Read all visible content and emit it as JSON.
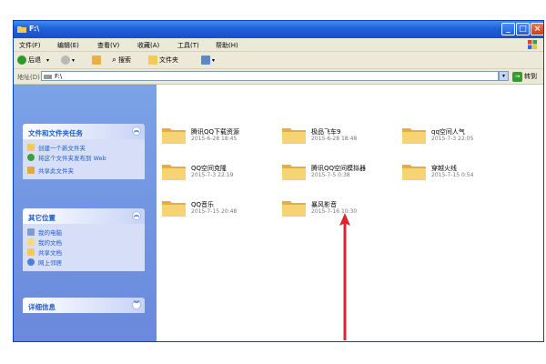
{
  "window": {
    "title": "F:\\"
  },
  "menu": [
    "文件(F)",
    "编辑(E)",
    "查看(V)",
    "收藏(A)",
    "工具(T)",
    "帮助(H)"
  ],
  "toolbar": {
    "back": "后退",
    "search": "搜索",
    "folders": "文件夹"
  },
  "address": {
    "label": "地址(D)",
    "value": "F:\\",
    "go": "转到"
  },
  "tasks_panel": {
    "title": "文件和文件夹任务",
    "items": [
      "创建一个新文件夹",
      "将这个文件夹发布到 Web",
      "共享此文件夹"
    ]
  },
  "places_panel": {
    "title": "其它位置",
    "items": [
      "我的电脑",
      "我的文档",
      "共享文档",
      "网上邻居"
    ]
  },
  "details_panel": {
    "title": "详细信息"
  },
  "files": [
    {
      "name": "腾讯QQ下载资源",
      "date": "2015-6-28 18:45"
    },
    {
      "name": "极品飞车9",
      "date": "2015-6-28 18:48"
    },
    {
      "name": "qq空间人气",
      "date": "2015-7-3 22:05"
    },
    {
      "name": "QQ空间克隆",
      "date": "2015-7-3 22:19"
    },
    {
      "name": "腾讯QQ空间模拟器",
      "date": "2015-7-5 0:38"
    },
    {
      "name": "穿越火线",
      "date": "2015-7-15 0:54"
    },
    {
      "name": "QQ音乐",
      "date": "2015-7-15 20:48"
    },
    {
      "name": "暴风影音",
      "date": "2015-7-16 10:30"
    }
  ],
  "colors": {
    "title_bar": "#1f5fd8",
    "sidebar": "#7ba2e7",
    "arrow": "#d9262e",
    "folder": "#f3c95a"
  }
}
